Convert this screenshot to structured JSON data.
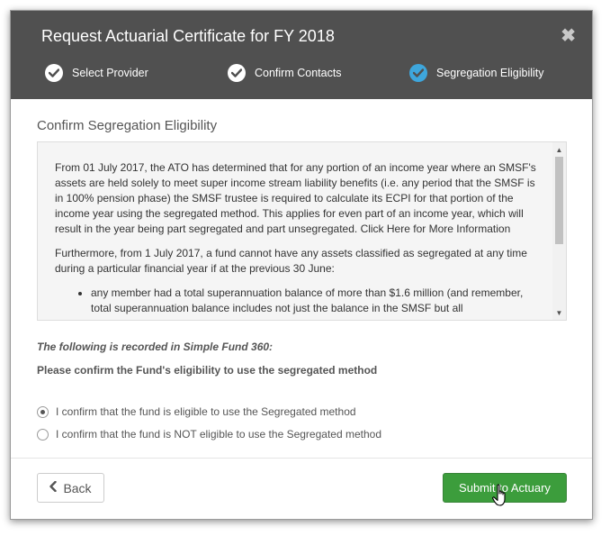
{
  "dialog": {
    "title": "Request Actuarial Certificate for FY 2018",
    "close_symbol": "✖"
  },
  "steps": [
    {
      "label": "Select Provider",
      "state": "complete"
    },
    {
      "label": "Confirm Contacts",
      "state": "complete"
    },
    {
      "label": "Segregation Eligibility",
      "state": "active"
    }
  ],
  "section": {
    "title": "Confirm Segregation Eligibility"
  },
  "info": {
    "paragraph1": "From 01 July 2017, the ATO has determined that for any portion of an income year where an SMSF's assets are held solely to meet super income stream liability benefits (i.e. any period that the SMSF is in 100% pension phase) the SMSF trustee is required to calculate its ECPI for that portion of the income year using the segregated method. This applies for even part of an income year, which will result in the year being part segregated and part unsegregated. Click Here for More Information",
    "paragraph2": "Furthermore, from 1 July 2017, a fund cannot have any assets classified as segregated at any time during a particular financial year if at the previous 30 June:",
    "bullet1": "any member had a total superannuation balance of more than $1.6 million (and remember, total superannuation balance includes not just the balance in the SMSF but all"
  },
  "recorded_label": "The following is recorded in Simple Fund 360:",
  "question": "Please confirm the Fund's eligibility to use the segregated method",
  "options": [
    {
      "label": "I confirm that the fund is eligible to use the Segregated method",
      "selected": true
    },
    {
      "label": "I confirm that the fund is NOT eligible to use the Segregated method",
      "selected": false
    }
  ],
  "footer": {
    "back_label": "Back",
    "submit_label": "Submit to Actuary"
  },
  "colors": {
    "header_bg": "#505050",
    "active_step": "#3ea6dc",
    "submit_bg": "#3c9d3c"
  }
}
